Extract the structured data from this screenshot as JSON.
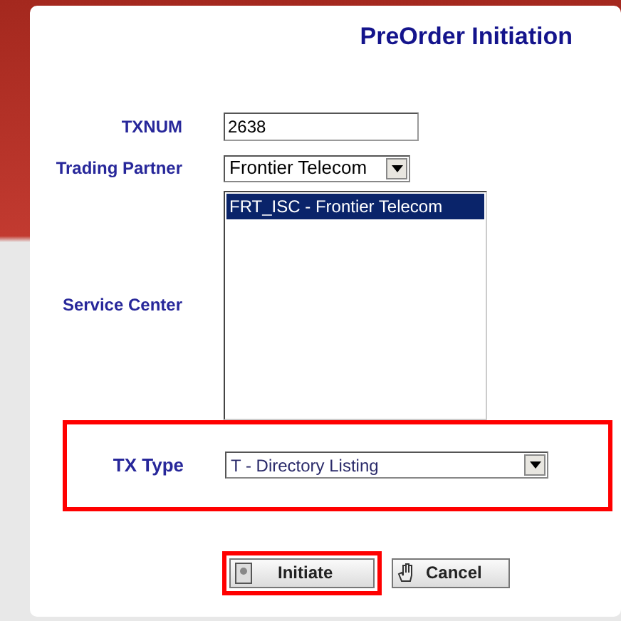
{
  "title": "PreOrder Initiation",
  "fields": [
    {
      "kind": "text",
      "label": "TXNUM",
      "value": "2638"
    },
    {
      "kind": "select",
      "label": "Trading Partner",
      "value": "Frontier Telecom"
    },
    {
      "kind": "list",
      "label": "Service Center",
      "options": [
        {
          "text": "FRT_ISC - Frontier Telecom",
          "selected": true
        }
      ]
    },
    {
      "kind": "wide-select",
      "label": "TX Type",
      "value": "T - Directory Listing",
      "highlighted": true
    }
  ],
  "buttons": [
    {
      "kind": "initiate",
      "label": "Initiate",
      "highlighted": true
    },
    {
      "kind": "cancel",
      "label": "Cancel",
      "highlighted": false
    }
  ]
}
